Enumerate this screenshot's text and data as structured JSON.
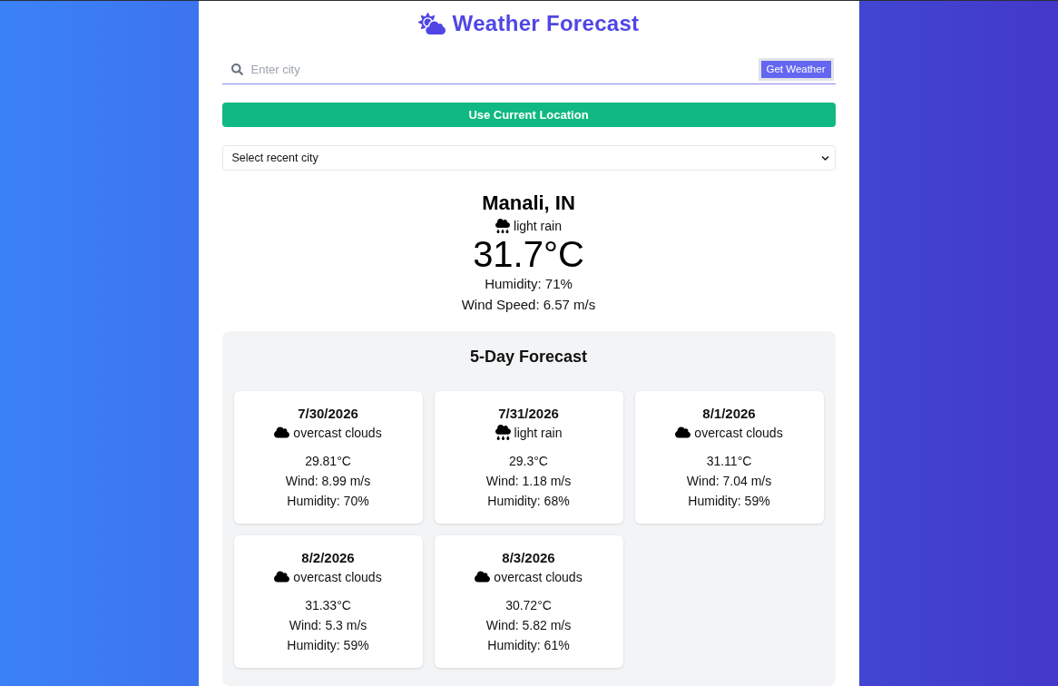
{
  "header": {
    "title": "Weather Forecast"
  },
  "search": {
    "placeholder": "Enter city",
    "button": "Get Weather"
  },
  "location_button": "Use Current Location",
  "recent_select": {
    "value": "Select recent city"
  },
  "current": {
    "city": "Manali, IN",
    "kind": "rain",
    "condition": "light rain",
    "temperature": "31.7°C",
    "humidity": "Humidity: 71%",
    "wind": "Wind Speed: 6.57 m/s"
  },
  "forecast": {
    "title": "5-Day Forecast",
    "days": [
      {
        "date": "7/30/2026",
        "kind": "clouds",
        "condition": "overcast clouds",
        "temperature": "29.81°C",
        "wind": "Wind: 8.99 m/s",
        "humidity": "Humidity: 70%"
      },
      {
        "date": "7/31/2026",
        "kind": "rain",
        "condition": "light rain",
        "temperature": "29.3°C",
        "wind": "Wind: 1.18 m/s",
        "humidity": "Humidity: 68%"
      },
      {
        "date": "8/1/2026",
        "kind": "clouds",
        "condition": "overcast clouds",
        "temperature": "31.11°C",
        "wind": "Wind: 7.04 m/s",
        "humidity": "Humidity: 59%"
      },
      {
        "date": "8/2/2026",
        "kind": "clouds",
        "condition": "overcast clouds",
        "temperature": "31.33°C",
        "wind": "Wind: 5.3 m/s",
        "humidity": "Humidity: 59%"
      },
      {
        "date": "8/3/2026",
        "kind": "clouds",
        "condition": "overcast clouds",
        "temperature": "30.72°C",
        "wind": "Wind: 5.82 m/s",
        "humidity": "Humidity: 61%"
      }
    ]
  }
}
